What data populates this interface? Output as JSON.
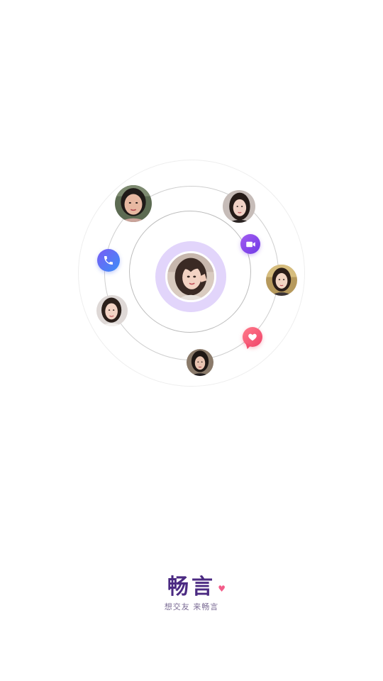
{
  "orbit": {
    "center_avatar": "avatar-photo",
    "avatars": [
      "avatar-photo-top-left",
      "avatar-photo-top-right",
      "avatar-photo-right",
      "avatar-photo-left",
      "avatar-photo-bottom"
    ],
    "badges": {
      "call_icon": "phone-icon",
      "video_icon": "video-camera-icon",
      "chat_icon": "heart-chat-icon"
    }
  },
  "brand": {
    "name": "畅言",
    "slogan": "想交友 来畅言",
    "heart": "♥"
  },
  "colors": {
    "background": "#ffffff",
    "halo": "#e2d5fb",
    "brand_text": "#4b2a82",
    "heart": "#f35d8a",
    "call_badge": "#5a78f4",
    "video_badge": "#8a4aeb",
    "chat_badge": "#f4506f"
  }
}
